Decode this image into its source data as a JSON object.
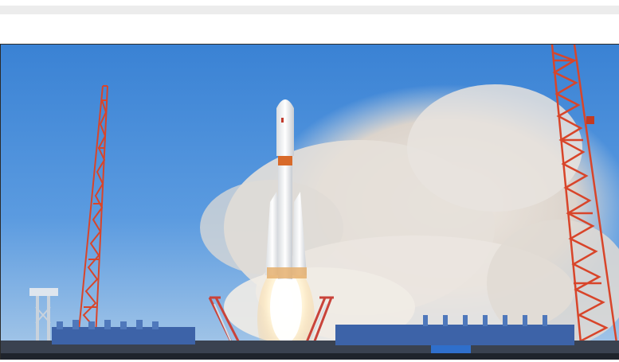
{
  "page": {
    "background": "#ffffff",
    "top_bar_color": "#ececec"
  },
  "photo": {
    "subject": "rocket-launch-photo",
    "colors": {
      "sky_top": "#3e86d6",
      "sky_bottom": "#8dbbe6",
      "smoke": "#e9e4df",
      "tower_red": "#d8452a",
      "rocket_white": "#f4f4f4",
      "rocket_orange": "#d86a2a",
      "exhaust": "#fff6e0",
      "pad_blue": "#3d63a8",
      "ground": "#2a2f3a"
    }
  }
}
